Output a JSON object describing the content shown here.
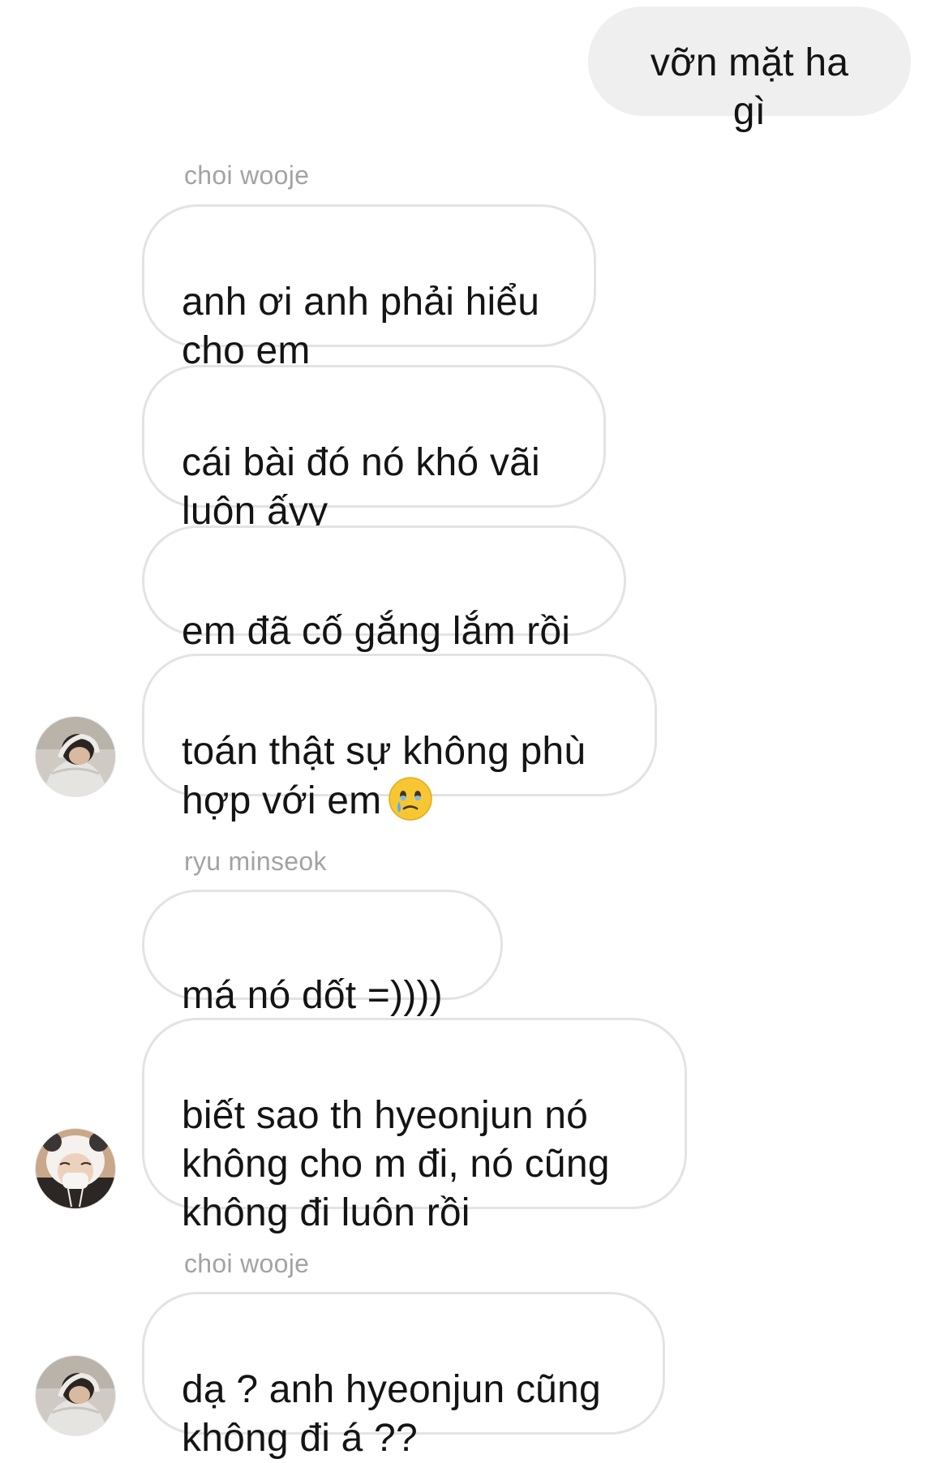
{
  "messages": {
    "m0": "vỡn mặt ha gì",
    "m1": "anh ơi anh phải hiểu\ncho em",
    "m2": "cái bài đó nó khó vãi\nluôn ấyy",
    "m3": "em đã cố gắng lắm rồi",
    "m4": "toán thật sự không phù\nhợp với em",
    "m4_emoji": "face-holding-back-tears-icon",
    "m5": "má nó dốt =))))",
    "m6": "biết sao th hyeonjun nó\nkhông cho m đi, nó cũng\nkhông đi luôn rồi",
    "m7": "dạ ? anh hyeonjun cũng\nkhông đi á ??"
  },
  "senders": {
    "s1": "choi wooje",
    "s2": "ryu minseok",
    "s3": "choi wooje"
  },
  "colors": {
    "outgoing_bubble": "#efefef",
    "incoming_border": "#e3e3e3",
    "sender_name": "#a3a3a3",
    "text": "#141414"
  }
}
